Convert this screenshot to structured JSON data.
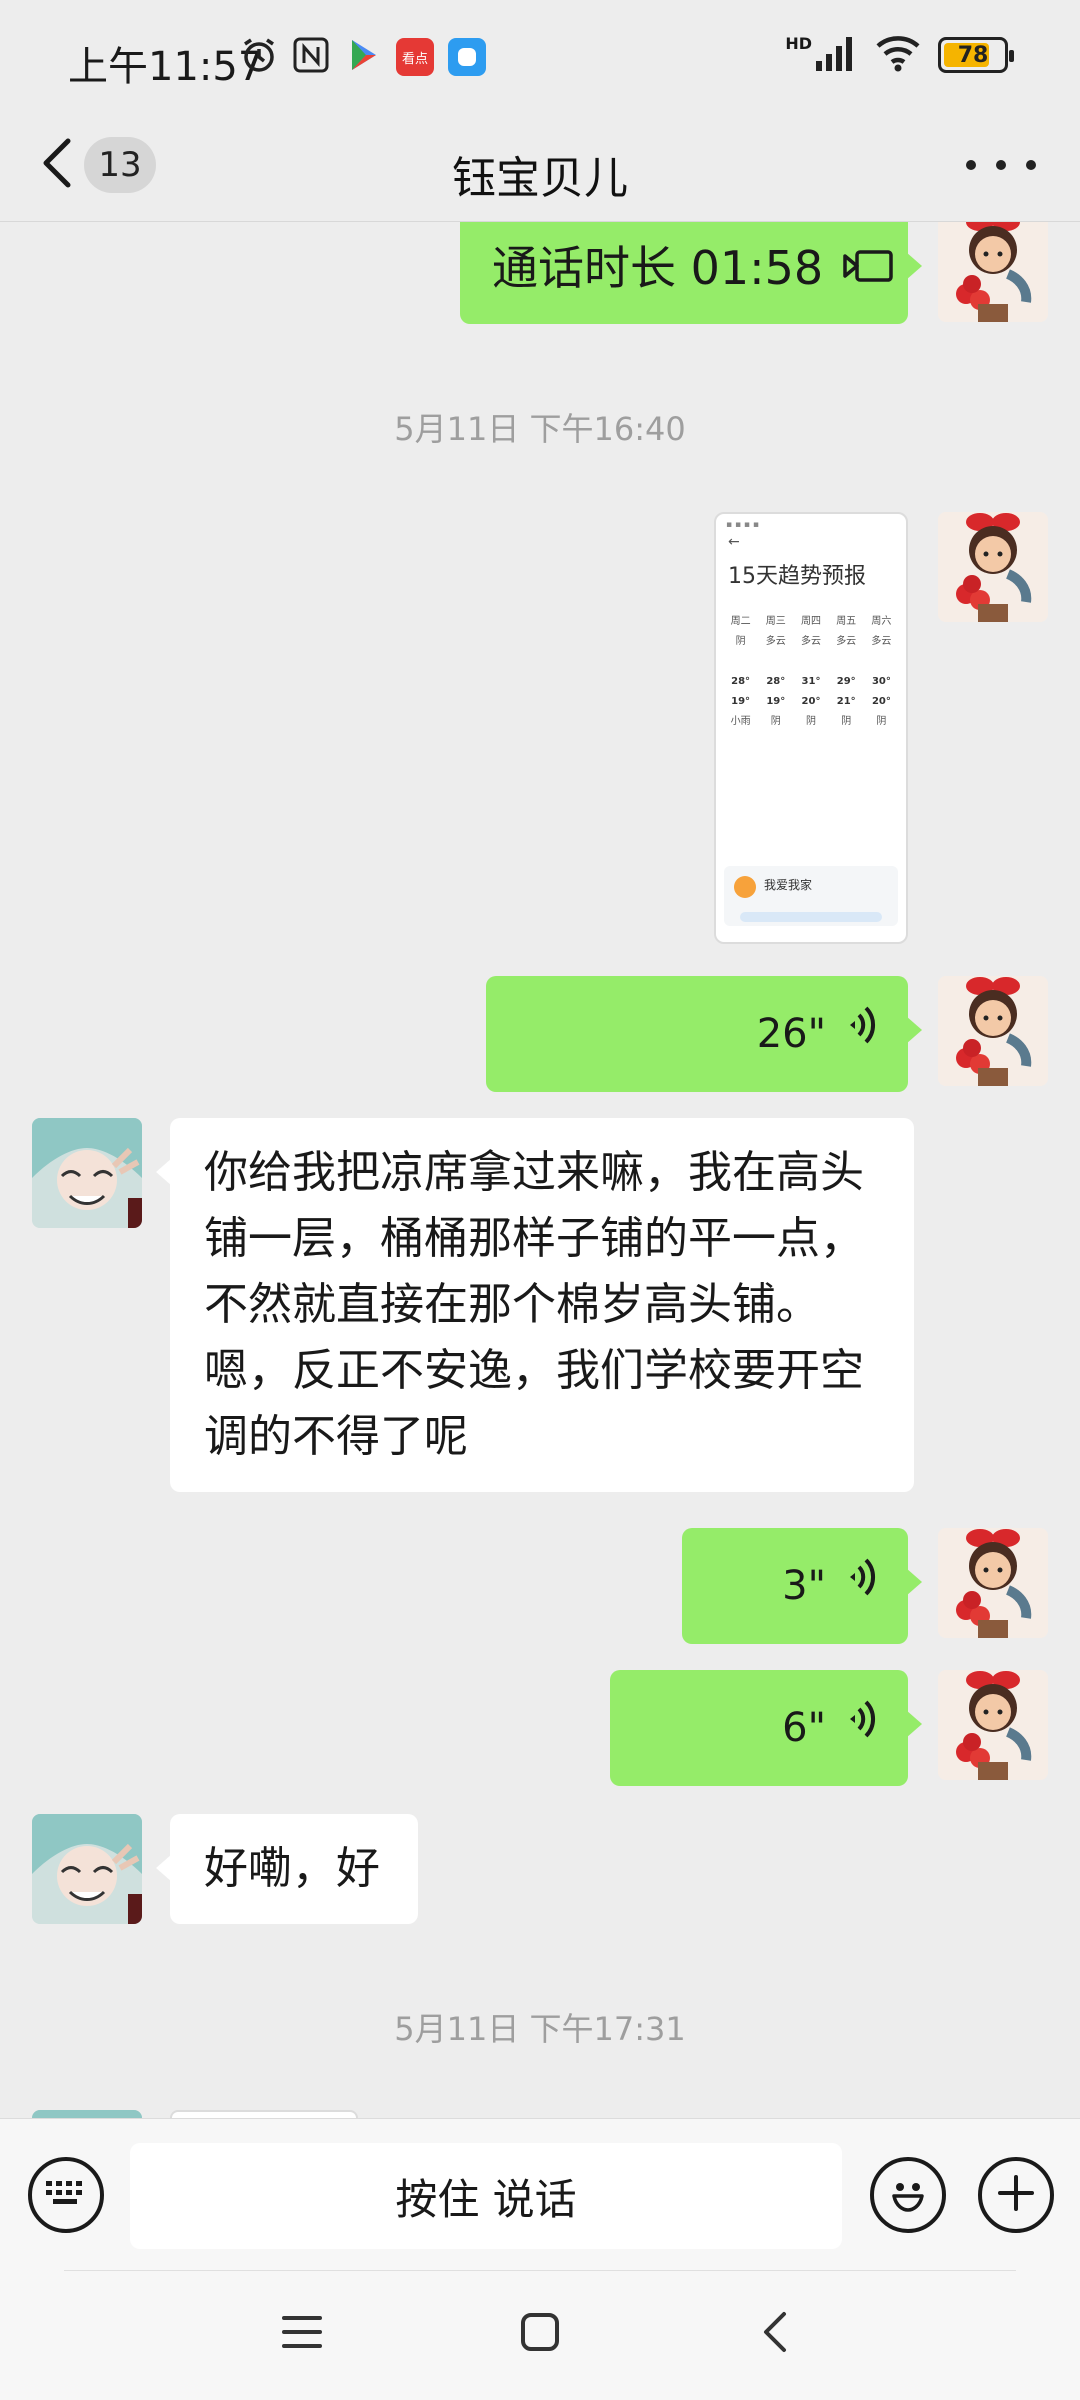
{
  "status_bar": {
    "time": "上午11:57",
    "network": "HD",
    "battery": 78,
    "app_badge": "看点"
  },
  "nav": {
    "unread_count": "13",
    "title": "钰宝贝儿"
  },
  "messages": {
    "call": {
      "text": "通话时长 01:58"
    },
    "time1": "5月11日 下午16:40",
    "screenshot": {
      "title": "15天趋势预报",
      "days": [
        "周二",
        "周三",
        "周四",
        "周五",
        "周六"
      ],
      "conditions": [
        "阴",
        "多云",
        "多云",
        "多云",
        "多云"
      ],
      "highs": [
        "28°",
        "28°",
        "31°",
        "29°",
        "30°"
      ],
      "lows": [
        "19°",
        "19°",
        "20°",
        "21°",
        "20°"
      ],
      "conditions2": [
        "小雨",
        "阴",
        "阴",
        "阴",
        "阴"
      ],
      "card_title": "我爱我家"
    },
    "voice1": "26\"",
    "text1": "你给我把凉席拿过来嘛，我在高头铺一层，桶桶那样子铺的平一点，不然就直接在那个棉岁高头铺。嗯，反正不安逸，我们学校要开空调的不得了呢",
    "voice2": "3\"",
    "voice3": "6\"",
    "text2": "好嘞，好",
    "time2": "5月11日 下午17:31"
  },
  "input": {
    "hold_label": "按住 说话"
  },
  "colors": {
    "bubble_me": "#95EC69",
    "bubble_them": "#FFFFFF",
    "background": "#EDEDED"
  }
}
